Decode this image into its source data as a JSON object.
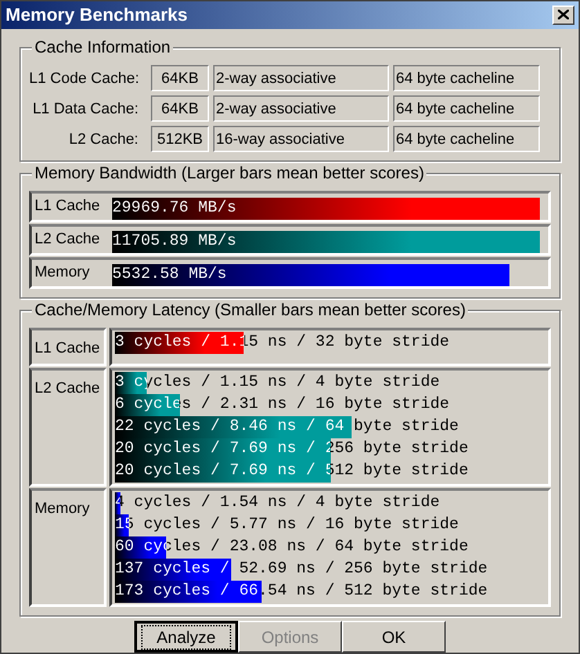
{
  "window": {
    "title": "Memory Benchmarks"
  },
  "cache_information": {
    "title": "Cache Information",
    "rows": [
      {
        "label": "L1 Code Cache:",
        "size": "64KB",
        "associativity": "2-way associative",
        "line": "64 byte cacheline"
      },
      {
        "label": "L1 Data Cache:",
        "size": "64KB",
        "associativity": "2-way associative",
        "line": "64 byte cacheline"
      },
      {
        "label": "L2 Cache:",
        "size": "512KB",
        "associativity": "16-way associative",
        "line": "64 byte cacheline"
      }
    ]
  },
  "memory_bandwidth": {
    "title": "Memory Bandwidth (Larger bars mean better scores)",
    "rows": [
      {
        "label": "L1 Cache",
        "reading": "29969.76 MB/s",
        "level": 0.99,
        "color": "#ff0000"
      },
      {
        "label": "L2 Cache",
        "reading": "11705.89 MB/s",
        "level": 0.99,
        "color": "#009c9c"
      },
      {
        "label": "Memory",
        "reading": "5532.58 MB/s",
        "level": 0.92,
        "color": "#0000ff"
      }
    ]
  },
  "latency": {
    "title": "Cache/Memory Latency (Smaller bars mean better scores)",
    "groups": [
      {
        "label": "L1 Cache",
        "color": "#ff0000",
        "results": [
          {
            "reading": "3 cycles / 1.15 ns / 32 byte stride",
            "level": 0.3
          }
        ]
      },
      {
        "label": "L2 Cache",
        "color": "#009c9c",
        "results": [
          {
            "reading": "3 cycles / 1.15 ns / 4 byte stride",
            "level": 0.075
          },
          {
            "reading": "6 cycles / 2.31 ns / 16 byte stride",
            "level": 0.15
          },
          {
            "reading": "22 cycles / 8.46 ns / 64 byte stride",
            "level": 0.55
          },
          {
            "reading": "20 cycles / 7.69 ns / 256 byte stride",
            "level": 0.5
          },
          {
            "reading": "20 cycles / 7.69 ns / 512 byte stride",
            "level": 0.5
          }
        ]
      },
      {
        "label": "Memory",
        "color": "#0000ff",
        "results": [
          {
            "reading": "4 cycles / 1.54 ns / 4 byte stride",
            "level": 0.012
          },
          {
            "reading": "15 cycles / 5.77 ns / 16 byte stride",
            "level": 0.033
          },
          {
            "reading": "60 cycles / 23.08 ns / 64 byte stride",
            "level": 0.12
          },
          {
            "reading": "137 cycles / 52.69 ns / 256 byte stride",
            "level": 0.27
          },
          {
            "reading": "173 cycles / 66.54 ns / 512 byte stride",
            "level": 0.34
          }
        ]
      }
    ]
  },
  "buttons": [
    {
      "label": "Analyze",
      "focused": true,
      "disabled": false
    },
    {
      "label": "Options",
      "focused": false,
      "disabled": true
    },
    {
      "label": "OK",
      "focused": false,
      "disabled": false
    }
  ]
}
